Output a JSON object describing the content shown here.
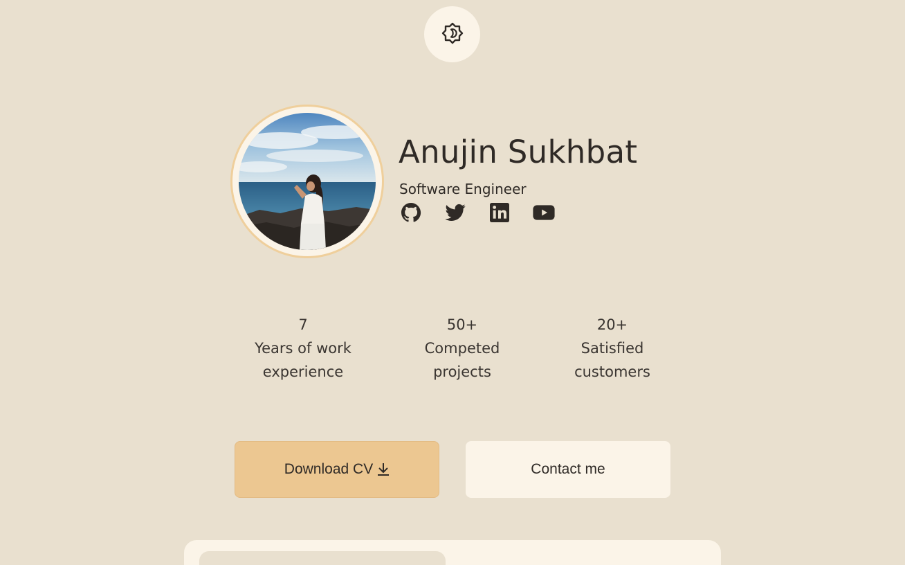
{
  "header": {
    "theme_toggle_icon": "sun-icon"
  },
  "profile": {
    "name": "Anujin Sukhbat",
    "role": "Software Engineer",
    "avatar_alt": "profile-photo",
    "socials": [
      {
        "icon": "github-icon"
      },
      {
        "icon": "twitter-icon"
      },
      {
        "icon": "linkedin-icon"
      },
      {
        "icon": "youtube-icon"
      }
    ]
  },
  "stats": [
    {
      "value": "7",
      "label": "Years of work experience"
    },
    {
      "value": "50+",
      "label": "Competed projects"
    },
    {
      "value": "20+",
      "label": "Satisfied customers"
    }
  ],
  "actions": {
    "download_label": "Download CV",
    "contact_label": "Contact me"
  },
  "colors": {
    "background": "#e9e0cf",
    "card": "#fbf4e8",
    "accent": "#ecc791",
    "text": "#2f2a26"
  }
}
